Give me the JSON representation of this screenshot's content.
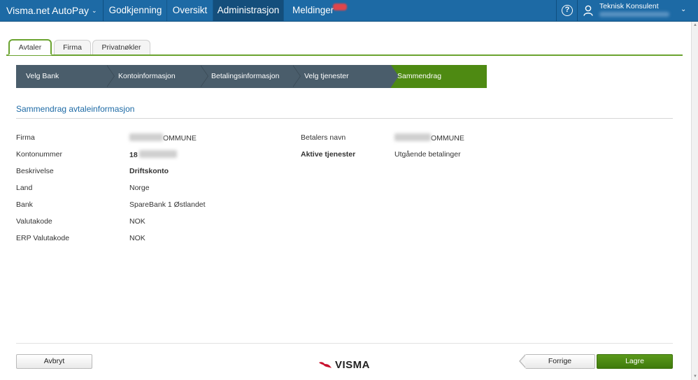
{
  "topnav": {
    "brand": "Visma.net AutoPay",
    "items": [
      {
        "label": "Godkjenning",
        "active": false
      },
      {
        "label": "Oversikt",
        "active": false
      },
      {
        "label": "Administrasjon",
        "active": true
      },
      {
        "label": "Meldinger",
        "active": false
      }
    ],
    "user_name": "Teknisk Konsulent",
    "help_glyph": "?",
    "colors": {
      "nav_bg": "#1d6aa5",
      "active_bg": "#144e7b",
      "badge": "#e0454b"
    }
  },
  "tabs": [
    {
      "label": "Avtaler",
      "active": true
    },
    {
      "label": "Firma",
      "active": false
    },
    {
      "label": "Privatnøkler",
      "active": false
    }
  ],
  "wizard": {
    "steps": [
      {
        "label": "Velg Bank",
        "active": false
      },
      {
        "label": "Kontoinformasjon",
        "active": false
      },
      {
        "label": "Betalingsinformasjon",
        "active": false
      },
      {
        "label": "Velg tjenester",
        "active": false
      },
      {
        "label": "Sammendrag",
        "active": true
      }
    ],
    "colors": {
      "inactive": "#4a5d6b",
      "active": "#4e8a12"
    }
  },
  "summary": {
    "title": "Sammendrag avtaleinformasjon",
    "left": [
      {
        "label": "Firma",
        "value": "OMMUNE",
        "masked": true
      },
      {
        "label": "Kontonummer",
        "value": "18",
        "masked": true
      },
      {
        "label": "Beskrivelse",
        "value": "Driftskonto",
        "masked": false
      },
      {
        "label": "Land",
        "value": "Norge",
        "masked": false
      },
      {
        "label": "Bank",
        "value": "SpareBank 1 Østlandet",
        "masked": false
      },
      {
        "label": "Valutakode",
        "value": "NOK",
        "masked": false
      },
      {
        "label": "ERP Valutakode",
        "value": "NOK",
        "masked": false
      }
    ],
    "right": [
      {
        "label": "Betalers navn",
        "value": "OMMUNE",
        "masked": true
      },
      {
        "label": "Aktive tjenester",
        "value": "Utgående betalinger",
        "masked": false
      }
    ]
  },
  "footer": {
    "cancel_label": "Avbryt",
    "previous_label": "Forrige",
    "save_label": "Lagre",
    "logo_text": "VISMA"
  }
}
